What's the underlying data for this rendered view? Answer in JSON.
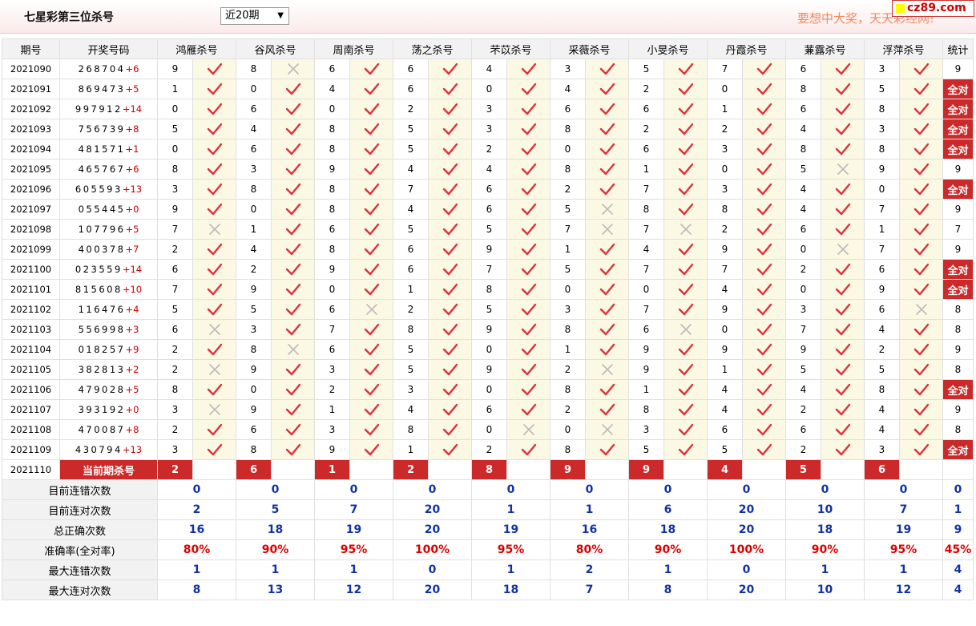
{
  "header": {
    "title": "七星彩第三位杀号",
    "period_select": "近20期",
    "slogan": "要想中大奖，天天彩经网!",
    "logo": "cz89.com"
  },
  "colors": {
    "accent_red": "#cc2a2a",
    "blue_value": "#1133aa",
    "red_value": "#dd0000",
    "mark_bg": "#fbf8e4"
  },
  "icons": {
    "correct": "red-check-icon",
    "wrong": "gray-cross-icon"
  },
  "table": {
    "col_issue": "期号",
    "col_numbers": "开奖号码",
    "col_stat": "统计",
    "experts": [
      "鸿雁杀号",
      "谷风杀号",
      "周南杀号",
      "荡之杀号",
      "芣苡杀号",
      "采薇杀号",
      "小旻杀号",
      "丹霞杀号",
      "蒹露杀号",
      "浮萍杀号"
    ],
    "rows": [
      {
        "issue": "2021090",
        "numbers": "268704",
        "plus": "+6",
        "kills": [
          9,
          8,
          6,
          6,
          4,
          3,
          5,
          7,
          6,
          3
        ],
        "ok": [
          1,
          0,
          1,
          1,
          1,
          1,
          1,
          1,
          1,
          1
        ],
        "stat": "9"
      },
      {
        "issue": "2021091",
        "numbers": "869473",
        "plus": "+5",
        "kills": [
          1,
          0,
          4,
          6,
          0,
          4,
          2,
          0,
          8,
          5
        ],
        "ok": [
          1,
          1,
          1,
          1,
          1,
          1,
          1,
          1,
          1,
          1
        ],
        "stat": "全对"
      },
      {
        "issue": "2021092",
        "numbers": "997912",
        "plus": "+14",
        "kills": [
          0,
          6,
          0,
          2,
          3,
          6,
          6,
          1,
          6,
          8
        ],
        "ok": [
          1,
          1,
          1,
          1,
          1,
          1,
          1,
          1,
          1,
          1
        ],
        "stat": "全对"
      },
      {
        "issue": "2021093",
        "numbers": "756739",
        "plus": "+8",
        "kills": [
          5,
          4,
          8,
          5,
          3,
          8,
          2,
          2,
          4,
          3
        ],
        "ok": [
          1,
          1,
          1,
          1,
          1,
          1,
          1,
          1,
          1,
          1
        ],
        "stat": "全对"
      },
      {
        "issue": "2021094",
        "numbers": "481571",
        "plus": "+1",
        "kills": [
          0,
          6,
          8,
          5,
          2,
          0,
          6,
          3,
          8,
          8
        ],
        "ok": [
          1,
          1,
          1,
          1,
          1,
          1,
          1,
          1,
          1,
          1
        ],
        "stat": "全对"
      },
      {
        "issue": "2021095",
        "numbers": "465767",
        "plus": "+6",
        "kills": [
          8,
          3,
          9,
          4,
          4,
          8,
          1,
          0,
          5,
          9
        ],
        "ok": [
          1,
          1,
          1,
          1,
          1,
          1,
          1,
          1,
          0,
          1
        ],
        "stat": "9"
      },
      {
        "issue": "2021096",
        "numbers": "605593",
        "plus": "+13",
        "kills": [
          3,
          8,
          8,
          7,
          6,
          2,
          7,
          3,
          4,
          0
        ],
        "ok": [
          1,
          1,
          1,
          1,
          1,
          1,
          1,
          1,
          1,
          1
        ],
        "stat": "全对"
      },
      {
        "issue": "2021097",
        "numbers": "055445",
        "plus": "+0",
        "kills": [
          9,
          0,
          8,
          4,
          6,
          5,
          8,
          8,
          4,
          7
        ],
        "ok": [
          1,
          1,
          1,
          1,
          1,
          0,
          1,
          1,
          1,
          1
        ],
        "stat": "9"
      },
      {
        "issue": "2021098",
        "numbers": "107796",
        "plus": "+5",
        "kills": [
          7,
          1,
          6,
          5,
          5,
          7,
          7,
          2,
          6,
          1
        ],
        "ok": [
          0,
          1,
          1,
          1,
          1,
          0,
          0,
          1,
          1,
          1
        ],
        "stat": "7"
      },
      {
        "issue": "2021099",
        "numbers": "400378",
        "plus": "+7",
        "kills": [
          2,
          4,
          8,
          6,
          9,
          1,
          4,
          9,
          0,
          7
        ],
        "ok": [
          1,
          1,
          1,
          1,
          1,
          1,
          1,
          1,
          0,
          1
        ],
        "stat": "9"
      },
      {
        "issue": "2021100",
        "numbers": "023559",
        "plus": "+14",
        "kills": [
          6,
          2,
          9,
          6,
          7,
          5,
          7,
          7,
          2,
          6
        ],
        "ok": [
          1,
          1,
          1,
          1,
          1,
          1,
          1,
          1,
          1,
          1
        ],
        "stat": "全对"
      },
      {
        "issue": "2021101",
        "numbers": "815608",
        "plus": "+10",
        "kills": [
          7,
          9,
          0,
          1,
          8,
          0,
          0,
          4,
          0,
          9
        ],
        "ok": [
          1,
          1,
          1,
          1,
          1,
          1,
          1,
          1,
          1,
          1
        ],
        "stat": "全对"
      },
      {
        "issue": "2021102",
        "numbers": "116476",
        "plus": "+4",
        "kills": [
          5,
          5,
          6,
          2,
          5,
          3,
          7,
          9,
          3,
          6
        ],
        "ok": [
          1,
          1,
          0,
          1,
          1,
          1,
          1,
          1,
          1,
          0
        ],
        "stat": "8"
      },
      {
        "issue": "2021103",
        "numbers": "556998",
        "plus": "+3",
        "kills": [
          6,
          3,
          7,
          8,
          9,
          8,
          6,
          0,
          7,
          4
        ],
        "ok": [
          0,
          1,
          1,
          1,
          1,
          1,
          0,
          1,
          1,
          1
        ],
        "stat": "8"
      },
      {
        "issue": "2021104",
        "numbers": "018257",
        "plus": "+9",
        "kills": [
          2,
          8,
          6,
          5,
          0,
          1,
          9,
          9,
          9,
          2
        ],
        "ok": [
          1,
          0,
          1,
          1,
          1,
          1,
          1,
          1,
          1,
          1
        ],
        "stat": "9"
      },
      {
        "issue": "2021105",
        "numbers": "382813",
        "plus": "+2",
        "kills": [
          2,
          9,
          3,
          5,
          9,
          2,
          9,
          1,
          5,
          5
        ],
        "ok": [
          0,
          1,
          1,
          1,
          1,
          0,
          1,
          1,
          1,
          1
        ],
        "stat": "8"
      },
      {
        "issue": "2021106",
        "numbers": "479028",
        "plus": "+5",
        "kills": [
          8,
          0,
          2,
          3,
          0,
          8,
          1,
          4,
          4,
          8
        ],
        "ok": [
          1,
          1,
          1,
          1,
          1,
          1,
          1,
          1,
          1,
          1
        ],
        "stat": "全对"
      },
      {
        "issue": "2021107",
        "numbers": "393192",
        "plus": "+0",
        "kills": [
          3,
          9,
          1,
          4,
          6,
          2,
          8,
          4,
          2,
          4
        ],
        "ok": [
          0,
          1,
          1,
          1,
          1,
          1,
          1,
          1,
          1,
          1
        ],
        "stat": "9"
      },
      {
        "issue": "2021108",
        "numbers": "470087",
        "plus": "+8",
        "kills": [
          2,
          6,
          3,
          8,
          0,
          0,
          3,
          6,
          6,
          4
        ],
        "ok": [
          1,
          1,
          1,
          1,
          0,
          0,
          1,
          1,
          1,
          1
        ],
        "stat": "8"
      },
      {
        "issue": "2021109",
        "numbers": "430794",
        "plus": "+13",
        "kills": [
          3,
          8,
          9,
          1,
          2,
          8,
          5,
          5,
          2,
          3
        ],
        "ok": [
          1,
          1,
          1,
          1,
          1,
          1,
          1,
          1,
          1,
          1
        ],
        "stat": "全对"
      }
    ],
    "current": {
      "issue": "2021110",
      "label": "当前期杀号",
      "kills": [
        2,
        6,
        1,
        2,
        8,
        9,
        9,
        4,
        5,
        6
      ]
    },
    "stats": [
      {
        "label": "目前连错次数",
        "style": "blue",
        "values": [
          "0",
          "0",
          "0",
          "0",
          "0",
          "0",
          "0",
          "0",
          "0",
          "0"
        ],
        "total": "0"
      },
      {
        "label": "目前连对次数",
        "style": "blue",
        "values": [
          "2",
          "5",
          "7",
          "20",
          "1",
          "1",
          "6",
          "20",
          "10",
          "7"
        ],
        "total": "1"
      },
      {
        "label": "总正确次数",
        "style": "blue",
        "values": [
          "16",
          "18",
          "19",
          "20",
          "19",
          "16",
          "18",
          "20",
          "18",
          "19"
        ],
        "total": "9"
      },
      {
        "label": "准确率(全对率)",
        "style": "red",
        "values": [
          "80%",
          "90%",
          "95%",
          "100%",
          "95%",
          "80%",
          "90%",
          "100%",
          "90%",
          "95%"
        ],
        "total": "45%"
      },
      {
        "label": "最大连错次数",
        "style": "blue",
        "values": [
          "1",
          "1",
          "1",
          "0",
          "1",
          "2",
          "1",
          "0",
          "1",
          "1"
        ],
        "total": "4"
      },
      {
        "label": "最大连对次数",
        "style": "blue",
        "values": [
          "8",
          "13",
          "12",
          "20",
          "18",
          "7",
          "8",
          "20",
          "10",
          "12"
        ],
        "total": "4"
      }
    ]
  }
}
